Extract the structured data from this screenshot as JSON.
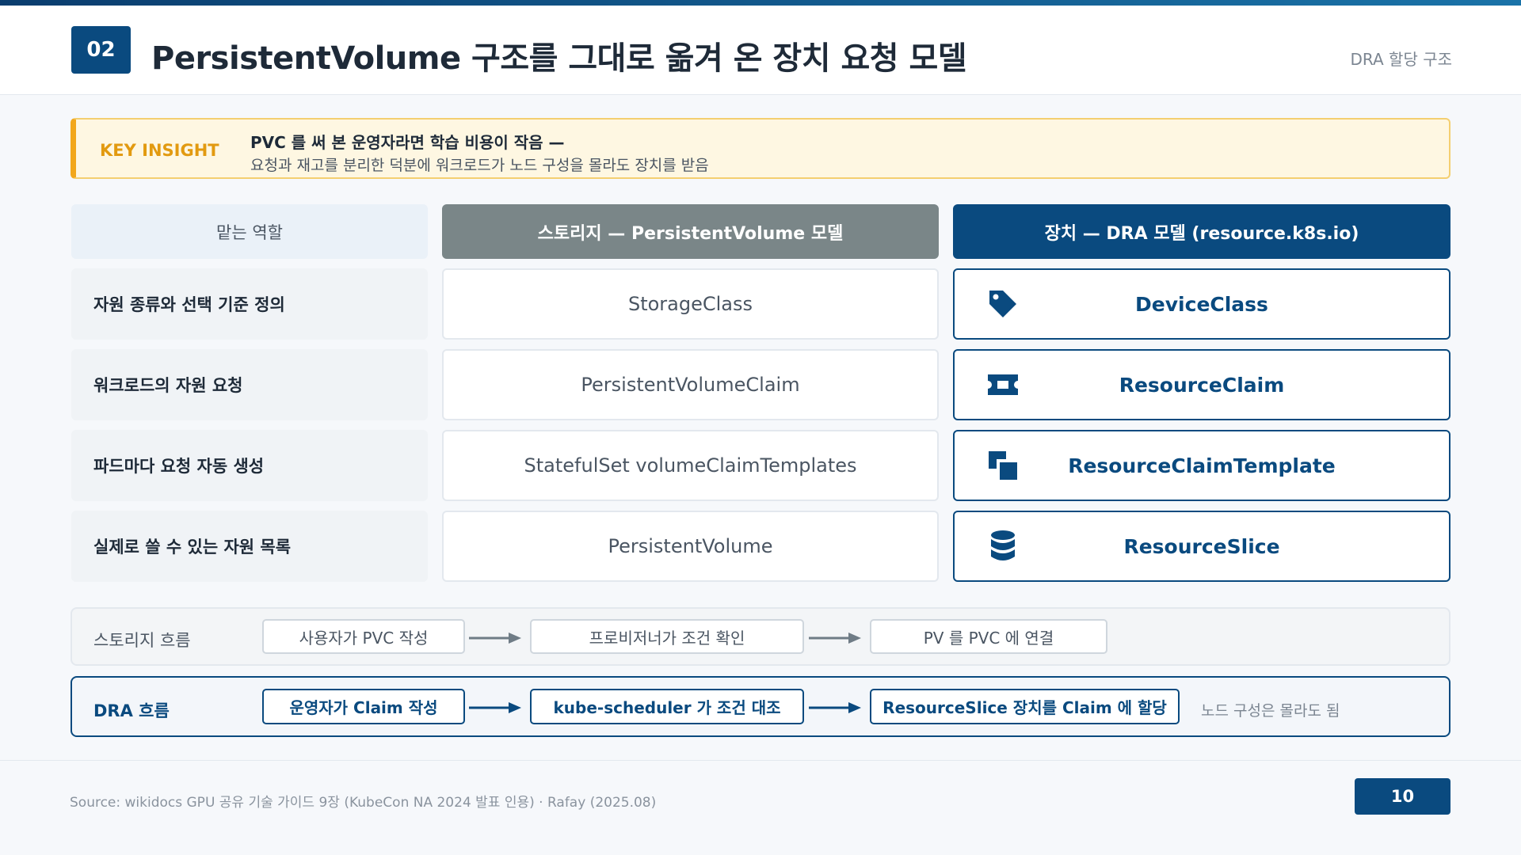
{
  "header": {
    "section_number": "02",
    "title": "PersistentVolume 구조를 그대로 옮겨 온 장치 요청 모델",
    "section_label": "DRA 할당 구조"
  },
  "insight": {
    "tag": "KEY INSIGHT",
    "title": "PVC 를 써 본 운영자라면 학습 비용이 작음 —",
    "body": "요청과 재고를 분리한 덕분에 워크로드가 노드 구성을 몰라도 장치를 받음"
  },
  "table": {
    "headers": {
      "role": "맡는 역할",
      "storage": "스토리지 — PersistentVolume 모델",
      "dra": "장치 — DRA 모델 (resource.k8s.io)"
    },
    "rows": [
      {
        "role": "자원 종류와 선택 기준 정의",
        "storage": "StorageClass",
        "dra": "DeviceClass",
        "icon": "tag-icon"
      },
      {
        "role": "워크로드의 자원 요청",
        "storage": "PersistentVolumeClaim",
        "dra": "ResourceClaim",
        "icon": "ticket-icon"
      },
      {
        "role": "파드마다 요청 자동 생성",
        "storage": "StatefulSet volumeClaimTemplates",
        "dra": "ResourceClaimTemplate",
        "icon": "clone-icon"
      },
      {
        "role": "실제로 쓸 수 있는 자원 목록",
        "storage": "PersistentVolume",
        "dra": "ResourceSlice",
        "icon": "database-icon"
      }
    ]
  },
  "flows": {
    "storage": {
      "label": "스토리지 흐름",
      "steps": [
        "사용자가 PVC 작성",
        "프로비저너가 조건 확인",
        "PV 를 PVC 에 연결"
      ]
    },
    "dra": {
      "label": "DRA 흐름",
      "steps": [
        "운영자가 Claim 작성",
        "kube-scheduler 가 조건 대조",
        "ResourceSlice 장치를 Claim 에 할당"
      ],
      "note": "노드 구성은 몰라도 됨"
    }
  },
  "footer": {
    "source": "Source: wikidocs GPU 공유 기술 가이드 9장 (KubeCon NA 2024 발표 인용) · Rafay (2025.08)",
    "page_number": "10"
  },
  "colors": {
    "primary": "#0a4a7f",
    "storage_header": "#7a8688",
    "insight_accent": "#f2a71b",
    "insight_bg": "#fef7e2"
  }
}
